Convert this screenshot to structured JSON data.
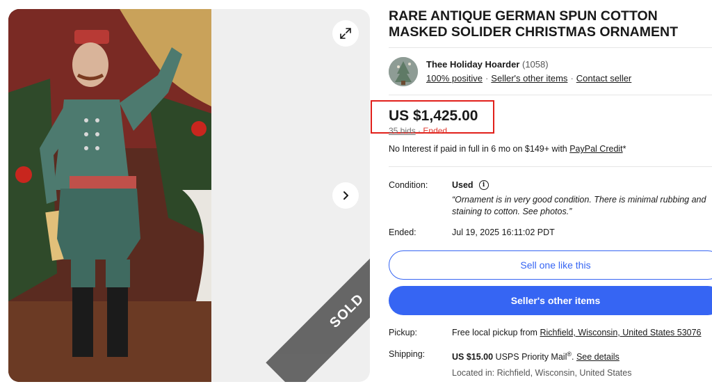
{
  "gallery": {
    "sold_label": "SOLD"
  },
  "listing": {
    "title": "RARE ANTIQUE GERMAN SPUN COTTON MASKED SOLIDER CHRISTMAS ORNAMENT"
  },
  "seller": {
    "name": "Thee Holiday Hoarder",
    "feedback_count": "(1058)",
    "positive": "100% positive",
    "other_items": "Seller's other items",
    "contact": "Contact seller"
  },
  "price": {
    "amount": "US $1,425.00",
    "bids": "35 bids",
    "separator": "·",
    "status": "Ended",
    "credit_text": "No Interest if paid in full in 6 mo on $149+ with ",
    "credit_link": "PayPal Credit",
    "credit_suffix": "*"
  },
  "details": {
    "condition_label": "Condition:",
    "condition_value": "Used",
    "condition_desc": "“Ornament is in very good condition. There is minimal rubbing and staining to cotton. See photos.”",
    "ended_label": "Ended:",
    "ended_value": "Jul 19, 2025 16:11:02 PDT"
  },
  "buttons": {
    "sell_one": "Sell one like this",
    "sellers_other": "Seller's other items"
  },
  "shipping": {
    "pickup_label": "Pickup:",
    "pickup_text": "Free local pickup from ",
    "pickup_location": "Richfield, Wisconsin, United States 53076",
    "shipping_label": "Shipping:",
    "shipping_price": "US $15.00",
    "shipping_service": " USPS Priority Mail",
    "reg_mark": "®",
    "shipping_period": ". ",
    "see_details": "See details",
    "located_in": "Located in: Richfield, Wisconsin, United States"
  },
  "icons": {
    "expand": "expand-icon",
    "next": "chevron-right-icon",
    "info": "info-icon"
  },
  "colors": {
    "accent": "#3665f3",
    "highlight_box": "#e1201b",
    "ended": "#e0352b"
  }
}
